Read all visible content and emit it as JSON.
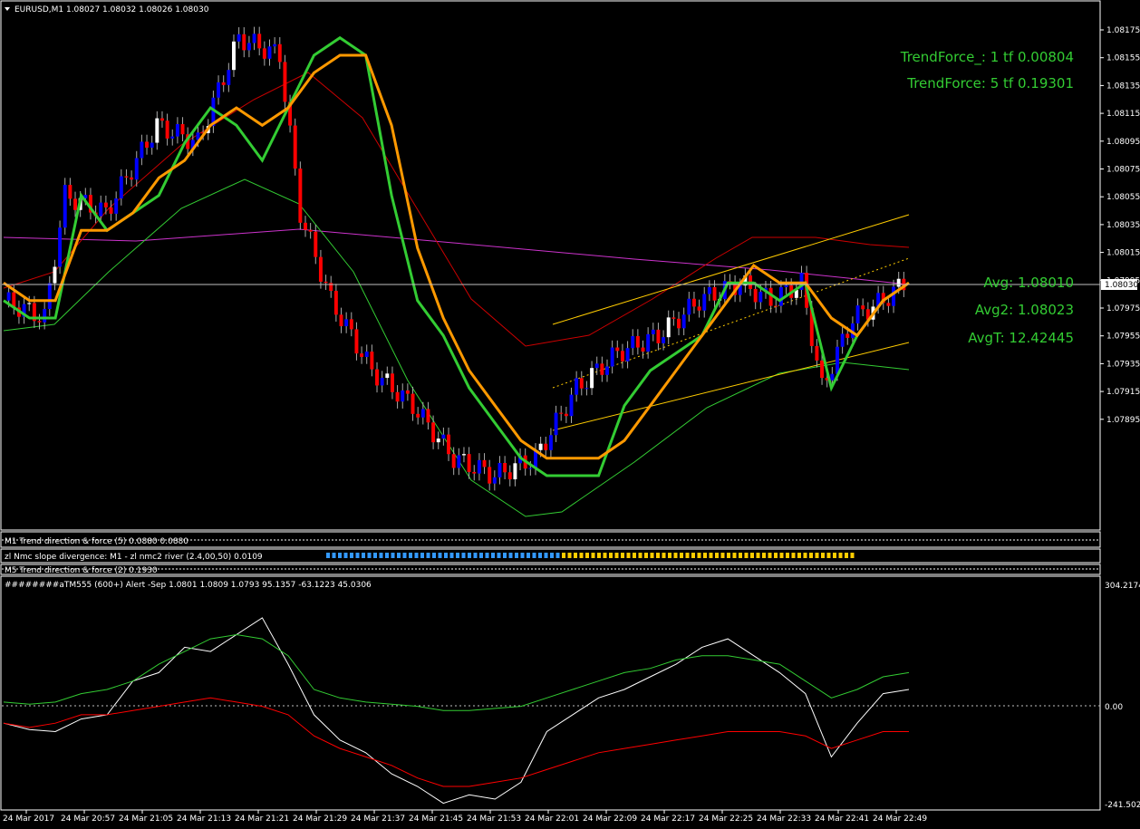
{
  "window": {
    "symbol_title": "EURUSD,M1  1.08027 1.08032 1.08026 1.08030",
    "menu_icon": "triangle-down-icon"
  },
  "overlay_texts": {
    "trend_force_1": "TrendForce_: 1 tf 0.00804",
    "trend_force_5": "TrendForce: 5 tf 0.19301",
    "avg": "Avg: 1.08010",
    "avg2": "Avg2: 1.08023",
    "avgt": "AvgT: 12.42445"
  },
  "indicator_labels": {
    "m1_trend": "M1 Trend direction & force (5) 0.0880 0.0880",
    "zl_nmc": "zl Nmc slope divergence:  M1 - zl nmc2 river  (2.4,00,50) 0.0109",
    "m5_trend": "M5 Trend direction & force (2) 0.1930",
    "tm555": "########aTM555 (600+) Alert -Sep 1.0801 1.0809 1.0793 95.1357 -63.1223 45.0306"
  },
  "price_axis": {
    "ticks": [
      "1.08175",
      "1.08155",
      "1.08135",
      "1.08115",
      "1.08095",
      "1.08075",
      "1.08055",
      "1.08035",
      "1.08015",
      "1.07995",
      "1.07975",
      "1.07955",
      "1.07935",
      "1.07915",
      "1.07895"
    ],
    "current": "1.08030"
  },
  "osc_axis": {
    "top": "304.2174",
    "zero": "0.00",
    "bottom": "-241.5024"
  },
  "time_axis": [
    "24 Mar 2017",
    "24 Mar 20:57",
    "24 Mar 21:05",
    "24 Mar 21:13",
    "24 Mar 21:21",
    "24 Mar 21:29",
    "24 Mar 21:37",
    "24 Mar 21:45",
    "24 Mar 21:53",
    "24 Mar 22:01",
    "24 Mar 22:09",
    "24 Mar 22:17",
    "24 Mar 22:25",
    "24 Mar 22:33",
    "24 Mar 22:41",
    "24 Mar 22:49"
  ],
  "colors": {
    "bull": "#0000ff",
    "bull_doji": "#ffffff",
    "bear": "#ff0000",
    "green_line": "#33cc33",
    "orange_line": "#ff9900",
    "red_band": "#cc0000",
    "magenta_ma": "#cc33cc",
    "yellow_channel": "#ffcc00",
    "osc_white": "#ffffff",
    "osc_green": "#33cc33",
    "osc_red": "#ff0000"
  },
  "chart_data": {
    "type": "line",
    "ylim": [
      1.0789,
      1.0819
    ],
    "price_curve_note": "",
    "series": [
      {
        "name": "",
        "values": [
          1.0802,
          1.0801,
          1.0801,
          1.0808,
          1.0806,
          1.0807,
          1.0808,
          1.0811,
          1.0813,
          1.0812,
          1.081,
          1.0813,
          1.0816,
          1.0817,
          1.0816,
          1.0808,
          1.0802,
          1.08,
          1.0797,
          1.0795,
          1.0793,
          1.0792,
          1.0792,
          1.0792,
          1.0796,
          1.0798,
          1.0799,
          1.08,
          1.0803,
          1.0803,
          1.0802,
          1.0803,
          1.0797,
          1.08,
          1.0802,
          1.0803
        ]
      },
      {
        "name": "",
        "values": [
          1.0803,
          1.0802,
          1.0802,
          1.0806,
          1.0806,
          1.0807,
          1.0809,
          1.081,
          1.0812,
          1.0813,
          1.0812,
          1.0813,
          1.0815,
          1.0816,
          1.0816,
          1.0812,
          1.0805,
          1.0801,
          1.0798,
          1.0796,
          1.0794,
          1.0793,
          1.0793,
          1.0793,
          1.0794,
          1.0796,
          1.0798,
          1.08,
          1.0802,
          1.0804,
          1.0803,
          1.0803,
          1.0801,
          1.08,
          1.0802,
          1.0803
        ]
      }
    ],
    "oscillator": {
      "ylim": [
        -241.5024,
        304.2174
      ],
      "series": [
        {
          "name": "",
          "values": [
            -40,
            -55,
            -60,
            -30,
            -20,
            60,
            80,
            140,
            130,
            170,
            210,
            100,
            -20,
            -80,
            -110,
            -160,
            -190,
            -230,
            -210,
            -220,
            -180,
            -60,
            -20,
            20,
            40,
            70,
            100,
            140,
            160,
            120,
            80,
            30,
            -120,
            -40,
            30,
            40
          ]
        },
        {
          "name": "",
          "values": [
            10,
            5,
            10,
            30,
            40,
            60,
            100,
            130,
            160,
            170,
            160,
            120,
            40,
            20,
            10,
            5,
            0,
            -10,
            -10,
            -5,
            0,
            20,
            40,
            60,
            80,
            90,
            110,
            120,
            120,
            110,
            100,
            60,
            20,
            40,
            70,
            80
          ]
        },
        {
          "name": "",
          "values": [
            -40,
            -50,
            -40,
            -20,
            -20,
            -10,
            0,
            10,
            20,
            10,
            0,
            -20,
            -70,
            -100,
            -120,
            -140,
            -170,
            -190,
            -190,
            -180,
            -170,
            -150,
            -130,
            -110,
            -100,
            -90,
            -80,
            -70,
            -60,
            -60,
            -60,
            -70,
            -100,
            -80,
            -60,
            -60
          ]
        }
      ]
    }
  }
}
